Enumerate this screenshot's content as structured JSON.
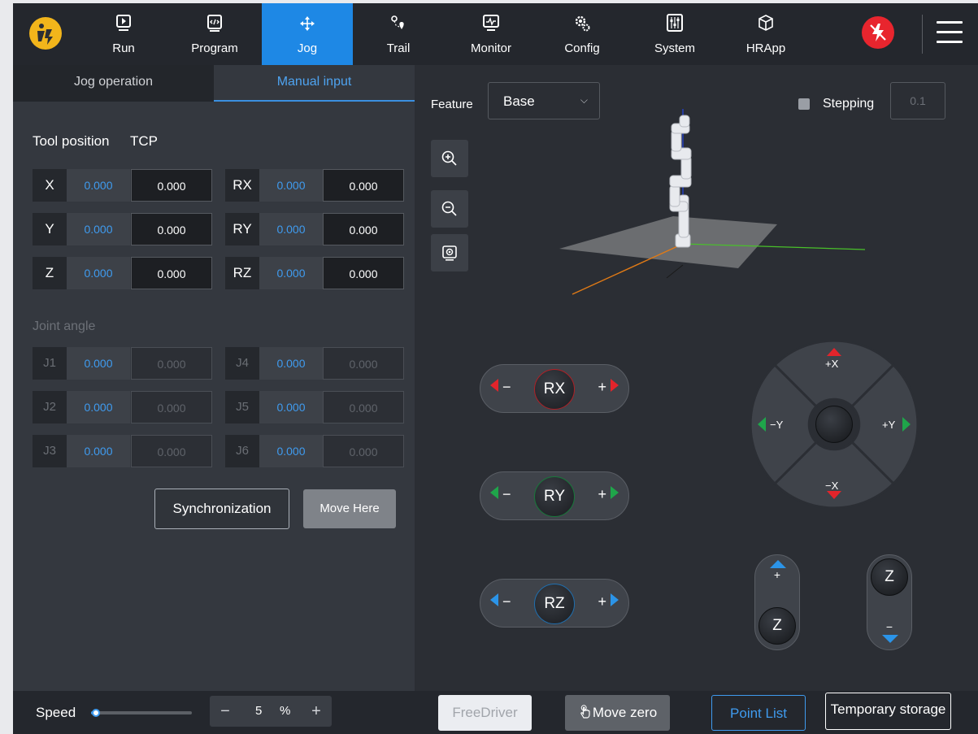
{
  "nav": {
    "items": [
      {
        "label": "Run",
        "icon": "play-icon"
      },
      {
        "label": "Program",
        "icon": "code-icon"
      },
      {
        "label": "Jog",
        "icon": "move-arrows-icon"
      },
      {
        "label": "Trail",
        "icon": "trail-icon"
      },
      {
        "label": "Monitor",
        "icon": "monitor-icon"
      },
      {
        "label": "Config",
        "icon": "gear-icon"
      },
      {
        "label": "System",
        "icon": "system-icon"
      },
      {
        "label": "HRApp",
        "icon": "cube-icon"
      }
    ],
    "active": "Jog"
  },
  "tabs": {
    "jog_operation": "Jog operation",
    "manual_input": "Manual input"
  },
  "tool": {
    "title": "Tool position",
    "frame": "TCP",
    "rows": [
      {
        "label": "X",
        "current": "0.000",
        "input": "0.000"
      },
      {
        "label": "Y",
        "current": "0.000",
        "input": "0.000"
      },
      {
        "label": "Z",
        "current": "0.000",
        "input": "0.000"
      },
      {
        "label": "RX",
        "current": "0.000",
        "input": "0.000"
      },
      {
        "label": "RY",
        "current": "0.000",
        "input": "0.000"
      },
      {
        "label": "RZ",
        "current": "0.000",
        "input": "0.000"
      }
    ]
  },
  "joint": {
    "title": "Joint angle",
    "rows": [
      {
        "label": "J1",
        "current": "0.000",
        "input": "0.000"
      },
      {
        "label": "J2",
        "current": "0.000",
        "input": "0.000"
      },
      {
        "label": "J3",
        "current": "0.000",
        "input": "0.000"
      },
      {
        "label": "J4",
        "current": "0.000",
        "input": "0.000"
      },
      {
        "label": "J5",
        "current": "0.000",
        "input": "0.000"
      },
      {
        "label": "J6",
        "current": "0.000",
        "input": "0.000"
      }
    ]
  },
  "buttons": {
    "sync": "Synchronization",
    "move_here": "Move Here"
  },
  "feature": {
    "label": "Feature",
    "value": "Base"
  },
  "stepping": {
    "label": "Stepping",
    "value": "0.1",
    "checked": false
  },
  "rotations": [
    {
      "label": "RX",
      "minus": "−",
      "plus": "+",
      "color": "#e3242b"
    },
    {
      "label": "RY",
      "minus": "−",
      "plus": "+",
      "color": "#1fa54a"
    },
    {
      "label": "RZ",
      "minus": "−",
      "plus": "+",
      "color": "#2b94e8"
    }
  ],
  "dpad": {
    "up": "+X",
    "down": "−X",
    "left": "−Y",
    "right": "+Y"
  },
  "zaxis": {
    "up_label": "Z",
    "up_sign": "+",
    "down_label": "Z",
    "down_sign": "−"
  },
  "bottom": {
    "speed_label": "Speed",
    "speed_value": "5",
    "speed_unit": "%",
    "speed_fraction": 0.05,
    "free_driver": "FreeDriver",
    "move_zero": "Move zero",
    "point_list": "Point List",
    "temporary_storage": "Temporary storage"
  },
  "colors": {
    "accent": "#1e88e5",
    "red": "#e3242b",
    "green": "#1fa54a",
    "blue": "#2b94e8",
    "estop": "#e8252e",
    "logo": "#f2b51b"
  }
}
